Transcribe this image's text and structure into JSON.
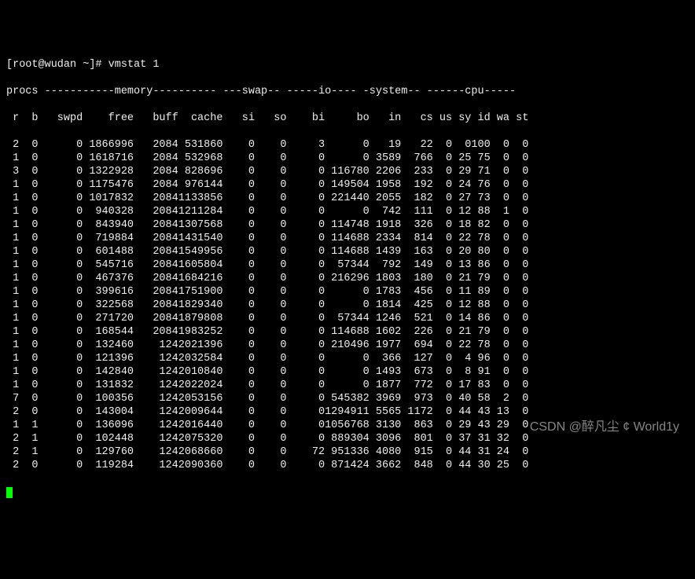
{
  "prompt": "[root@wudan ~]#",
  "command": "vmstat 1",
  "group_header": "procs -----------memory---------- ---swap-- -----io---- -system-- ------cpu-----",
  "columns": [
    "r",
    "b",
    "swpd",
    "free",
    "buff",
    "cache",
    "si",
    "so",
    "bi",
    "bo",
    "in",
    "cs",
    "us",
    "sy",
    "id",
    "wa",
    "st"
  ],
  "rows": [
    {
      "r": 2,
      "b": 0,
      "swpd": 0,
      "free": 1866996,
      "buff": 2084,
      "cache": 531860,
      "si": 0,
      "so": 0,
      "bi": 3,
      "bo": 0,
      "in": 19,
      "cs": 22,
      "us": 0,
      "sy": 0,
      "id": 100,
      "wa": 0,
      "st": 0
    },
    {
      "r": 1,
      "b": 0,
      "swpd": 0,
      "free": 1618716,
      "buff": 2084,
      "cache": 532968,
      "si": 0,
      "so": 0,
      "bi": 0,
      "bo": 0,
      "in": 3589,
      "cs": 766,
      "us": 0,
      "sy": 25,
      "id": 75,
      "wa": 0,
      "st": 0
    },
    {
      "r": 3,
      "b": 0,
      "swpd": 0,
      "free": 1322928,
      "buff": 2084,
      "cache": 828696,
      "si": 0,
      "so": 0,
      "bi": 0,
      "bo": 116780,
      "in": 2206,
      "cs": 233,
      "us": 0,
      "sy": 29,
      "id": 71,
      "wa": 0,
      "st": 0
    },
    {
      "r": 1,
      "b": 0,
      "swpd": 0,
      "free": 1175476,
      "buff": 2084,
      "cache": 976144,
      "si": 0,
      "so": 0,
      "bi": 0,
      "bo": 149504,
      "in": 1958,
      "cs": 192,
      "us": 0,
      "sy": 24,
      "id": 76,
      "wa": 0,
      "st": 0
    },
    {
      "r": 1,
      "b": 0,
      "swpd": 0,
      "free": 1017832,
      "buff": 2084,
      "cache": 1133856,
      "si": 0,
      "so": 0,
      "bi": 0,
      "bo": 221440,
      "in": 2055,
      "cs": 182,
      "us": 0,
      "sy": 27,
      "id": 73,
      "wa": 0,
      "st": 0
    },
    {
      "r": 1,
      "b": 0,
      "swpd": 0,
      "free": 940328,
      "buff": 2084,
      "cache": 1211284,
      "si": 0,
      "so": 0,
      "bi": 0,
      "bo": 0,
      "in": 742,
      "cs": 111,
      "us": 0,
      "sy": 12,
      "id": 88,
      "wa": 1,
      "st": 0
    },
    {
      "r": 1,
      "b": 0,
      "swpd": 0,
      "free": 843940,
      "buff": 2084,
      "cache": 1307568,
      "si": 0,
      "so": 0,
      "bi": 0,
      "bo": 114748,
      "in": 1918,
      "cs": 326,
      "us": 0,
      "sy": 18,
      "id": 82,
      "wa": 0,
      "st": 0
    },
    {
      "r": 1,
      "b": 0,
      "swpd": 0,
      "free": 719884,
      "buff": 2084,
      "cache": 1431540,
      "si": 0,
      "so": 0,
      "bi": 0,
      "bo": 114688,
      "in": 2334,
      "cs": 814,
      "us": 0,
      "sy": 22,
      "id": 78,
      "wa": 0,
      "st": 0
    },
    {
      "r": 1,
      "b": 0,
      "swpd": 0,
      "free": 601488,
      "buff": 2084,
      "cache": 1549956,
      "si": 0,
      "so": 0,
      "bi": 0,
      "bo": 114688,
      "in": 1439,
      "cs": 163,
      "us": 0,
      "sy": 20,
      "id": 80,
      "wa": 0,
      "st": 0
    },
    {
      "r": 1,
      "b": 0,
      "swpd": 0,
      "free": 545716,
      "buff": 2084,
      "cache": 1605804,
      "si": 0,
      "so": 0,
      "bi": 0,
      "bo": 57344,
      "in": 792,
      "cs": 149,
      "us": 0,
      "sy": 13,
      "id": 86,
      "wa": 0,
      "st": 0
    },
    {
      "r": 1,
      "b": 0,
      "swpd": 0,
      "free": 467376,
      "buff": 2084,
      "cache": 1684216,
      "si": 0,
      "so": 0,
      "bi": 0,
      "bo": 216296,
      "in": 1803,
      "cs": 180,
      "us": 0,
      "sy": 21,
      "id": 79,
      "wa": 0,
      "st": 0
    },
    {
      "r": 1,
      "b": 0,
      "swpd": 0,
      "free": 399616,
      "buff": 2084,
      "cache": 1751900,
      "si": 0,
      "so": 0,
      "bi": 0,
      "bo": 0,
      "in": 1783,
      "cs": 456,
      "us": 0,
      "sy": 11,
      "id": 89,
      "wa": 0,
      "st": 0
    },
    {
      "r": 1,
      "b": 0,
      "swpd": 0,
      "free": 322568,
      "buff": 2084,
      "cache": 1829340,
      "si": 0,
      "so": 0,
      "bi": 0,
      "bo": 0,
      "in": 1814,
      "cs": 425,
      "us": 0,
      "sy": 12,
      "id": 88,
      "wa": 0,
      "st": 0
    },
    {
      "r": 1,
      "b": 0,
      "swpd": 0,
      "free": 271720,
      "buff": 2084,
      "cache": 1879808,
      "si": 0,
      "so": 0,
      "bi": 0,
      "bo": 57344,
      "in": 1246,
      "cs": 521,
      "us": 0,
      "sy": 14,
      "id": 86,
      "wa": 0,
      "st": 0
    },
    {
      "r": 1,
      "b": 0,
      "swpd": 0,
      "free": 168544,
      "buff": 2084,
      "cache": 1983252,
      "si": 0,
      "so": 0,
      "bi": 0,
      "bo": 114688,
      "in": 1602,
      "cs": 226,
      "us": 0,
      "sy": 21,
      "id": 79,
      "wa": 0,
      "st": 0
    },
    {
      "r": 1,
      "b": 0,
      "swpd": 0,
      "free": 132460,
      "buff": 124,
      "cache": 2021396,
      "si": 0,
      "so": 0,
      "bi": 0,
      "bo": 210496,
      "in": 1977,
      "cs": 694,
      "us": 0,
      "sy": 22,
      "id": 78,
      "wa": 0,
      "st": 0
    },
    {
      "r": 1,
      "b": 0,
      "swpd": 0,
      "free": 121396,
      "buff": 124,
      "cache": 2032584,
      "si": 0,
      "so": 0,
      "bi": 0,
      "bo": 0,
      "in": 366,
      "cs": 127,
      "us": 0,
      "sy": 4,
      "id": 96,
      "wa": 0,
      "st": 0
    },
    {
      "r": 1,
      "b": 0,
      "swpd": 0,
      "free": 142840,
      "buff": 124,
      "cache": 2010840,
      "si": 0,
      "so": 0,
      "bi": 0,
      "bo": 0,
      "in": 1493,
      "cs": 673,
      "us": 0,
      "sy": 8,
      "id": 91,
      "wa": 0,
      "st": 0
    },
    {
      "r": 1,
      "b": 0,
      "swpd": 0,
      "free": 131832,
      "buff": 124,
      "cache": 2022024,
      "si": 0,
      "so": 0,
      "bi": 0,
      "bo": 0,
      "in": 1877,
      "cs": 772,
      "us": 0,
      "sy": 17,
      "id": 83,
      "wa": 0,
      "st": 0
    },
    {
      "r": 7,
      "b": 0,
      "swpd": 0,
      "free": 100356,
      "buff": 124,
      "cache": 2053156,
      "si": 0,
      "so": 0,
      "bi": 0,
      "bo": 545382,
      "in": 3969,
      "cs": 973,
      "us": 0,
      "sy": 40,
      "id": 58,
      "wa": 2,
      "st": 0
    },
    {
      "r": 2,
      "b": 0,
      "swpd": 0,
      "free": 143004,
      "buff": 124,
      "cache": 2009644,
      "si": 0,
      "so": 0,
      "bi": 0,
      "bo": 1294911,
      "in": 5565,
      "cs": 1172,
      "us": 0,
      "sy": 44,
      "id": 43,
      "wa": 13,
      "st": 0
    },
    {
      "r": 1,
      "b": 1,
      "swpd": 0,
      "free": 136096,
      "buff": 124,
      "cache": 2016440,
      "si": 0,
      "so": 0,
      "bi": 0,
      "bo": 1056768,
      "in": 3130,
      "cs": 863,
      "us": 0,
      "sy": 29,
      "id": 43,
      "wa": 29,
      "st": 0
    },
    {
      "r": 2,
      "b": 1,
      "swpd": 0,
      "free": 102448,
      "buff": 124,
      "cache": 2075320,
      "si": 0,
      "so": 0,
      "bi": 0,
      "bo": 889304,
      "in": 3096,
      "cs": 801,
      "us": 0,
      "sy": 37,
      "id": 31,
      "wa": 32,
      "st": 0
    },
    {
      "r": 2,
      "b": 1,
      "swpd": 0,
      "free": 129760,
      "buff": 124,
      "cache": 2068660,
      "si": 0,
      "so": 0,
      "bi": 72,
      "bo": 951336,
      "in": 4080,
      "cs": 915,
      "us": 0,
      "sy": 44,
      "id": 31,
      "wa": 24,
      "st": 0
    },
    {
      "r": 2,
      "b": 0,
      "swpd": 0,
      "free": 119284,
      "buff": 124,
      "cache": 2090360,
      "si": 0,
      "so": 0,
      "bi": 0,
      "bo": 871424,
      "in": 3662,
      "cs": 848,
      "us": 0,
      "sy": 44,
      "id": 30,
      "wa": 25,
      "st": 0
    }
  ],
  "watermark": "CSDN @醉凡尘 ¢  World1y"
}
